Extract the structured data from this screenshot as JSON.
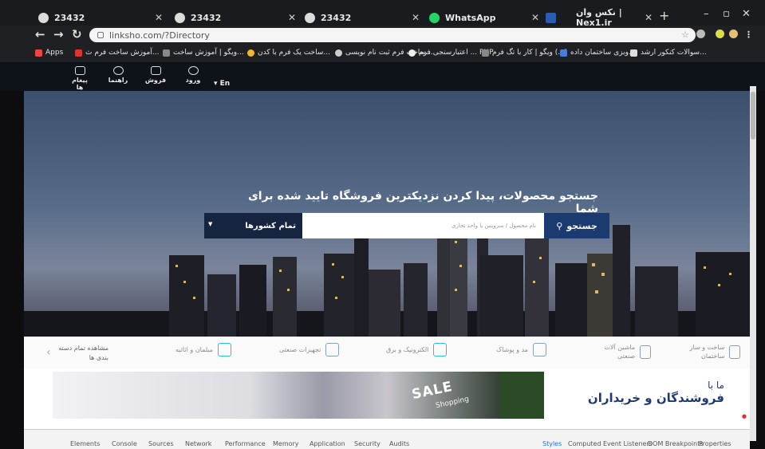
{
  "browser": {
    "tabs": [
      {
        "title": "23432",
        "icon": "globe-icon"
      },
      {
        "title": "23432",
        "icon": "globe-icon"
      },
      {
        "title": "23432",
        "icon": "globe-icon"
      },
      {
        "title": "WhatsApp",
        "icon": "whatsapp-icon"
      },
      {
        "title": "",
        "icon": "app-icon"
      },
      {
        "title": "نکس وان | Nex1.ir",
        "icon": "nex1-icon"
      }
    ],
    "new_tab": "+",
    "url": "linksho.com/?Directory",
    "bookmarks": [
      {
        "label": "Apps"
      },
      {
        "label": "آموزش ساخت فرم ث..."
      },
      {
        "label": "ویگو | آموزش ساخت..."
      },
      {
        "label": "ساخت یک فرم با کدن..."
      },
      {
        "label": "ساخت فرم ثبت نام نویسی..."
      },
      {
        "label": "اعتبارسنجی فرم ... PHP"
      },
      {
        "label": "ویگو | کار با تگ فرم (...)"
      },
      {
        "label": "وبزی ساختمان داده..."
      },
      {
        "label": "سوالات کنکور ارشد..."
      }
    ]
  },
  "site": {
    "nav": {
      "messages": "پیغام ها",
      "guide": "راهنما",
      "sell": "فروش",
      "login": "ورود",
      "language": "En"
    },
    "hero": {
      "title": "جستجو محصولات، پیدا کردن نزدیکترین فروشگاه تایید شده برای شما",
      "search_placeholder": "نام محصول / سرویس یا واحد تجاری",
      "search_button": "جستجو",
      "country_select": "تمام کشورها"
    },
    "categories": [
      {
        "label": "ساخت و ساز ساختمان",
        "icon": "building-icon"
      },
      {
        "label": "ماشین آلات صنعتی",
        "icon": "factory-icon"
      },
      {
        "label": "مد و پوشاک",
        "icon": "shirt-icon"
      },
      {
        "label": "الکترونیک و برق",
        "icon": "plug-icon"
      },
      {
        "label": "تجهیزات صنعتی",
        "icon": "tower-icon"
      },
      {
        "label": "مبلمان و اثاثیه",
        "icon": "sofa-icon"
      }
    ],
    "view_all_categories": "مشاهده تمام دسته بندی ها",
    "banner": {
      "sale": "SALE",
      "shopping": "Shopping",
      "tagline_1": "ما با",
      "tagline_2": "فروشندگان و خریداران"
    }
  },
  "devtools": {
    "tabs": [
      "Elements",
      "Console",
      "Sources",
      "Network",
      "Performance",
      "Memory",
      "Application",
      "Security",
      "Audits"
    ],
    "side_tabs": [
      "Styles",
      "Computed",
      "Event Listeners",
      "DOM Breakpoints",
      "Properties"
    ]
  },
  "colors": {
    "header_bg": "#0e1219",
    "search_button": "#1b3a70",
    "country_select": "#16243f",
    "tagline": "#1f3a6e",
    "accent_teal": "#27c0d8"
  }
}
